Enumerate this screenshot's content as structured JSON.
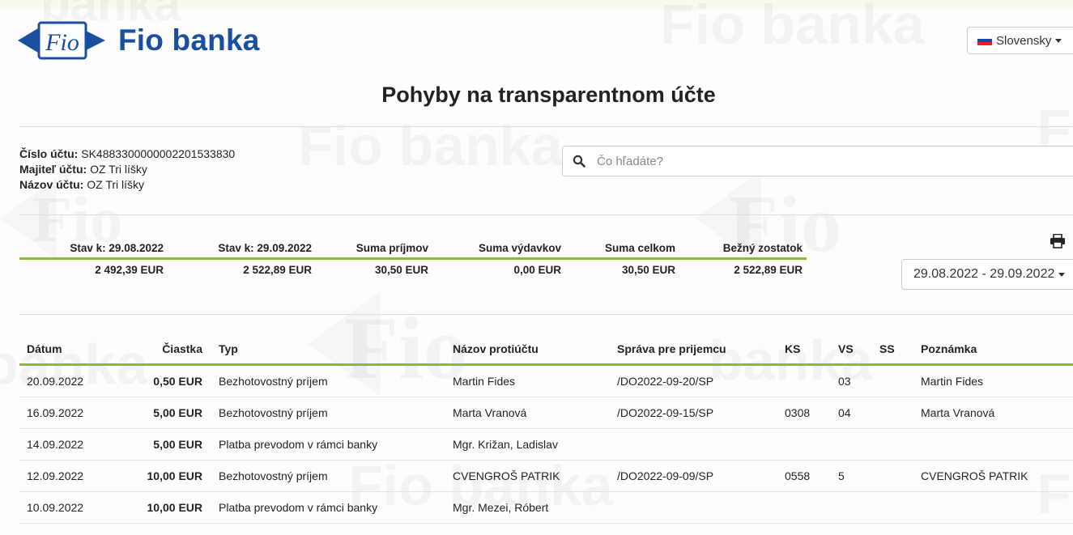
{
  "brand": {
    "name": "Fio banka",
    "logo_mark": "Fio",
    "blue": "#1a4e9f",
    "accent_green": "#8bba3a"
  },
  "language": {
    "selected": "Slovensky",
    "flag_icon": "slovak-flag-icon"
  },
  "page_title": "Pohyby na transparentnom účte",
  "account": {
    "number_label": "Číslo účtu:",
    "number_value": "SK4883300000002201533830",
    "owner_label": "Majiteľ účtu:",
    "owner_value": "OZ Tri líšky",
    "name_label": "Názov účtu:",
    "name_value": "OZ Tri líšky"
  },
  "search": {
    "placeholder": "Čo hľadáte?",
    "value": "",
    "icon": "search-icon"
  },
  "summary": {
    "headers": [
      "Stav k: 29.08.2022",
      "Stav k: 29.09.2022",
      "Suma príjmov",
      "Suma výdavkov",
      "Suma celkom",
      "Bežný zostatok"
    ],
    "values": [
      "2 492,39 EUR",
      "2 522,89 EUR",
      "30,50 EUR",
      "0,00 EUR",
      "30,50 EUR",
      "2 522,89 EUR"
    ]
  },
  "print_icon": "printer-icon",
  "date_range": "29.08.2022 - 29.09.2022",
  "table": {
    "columns": [
      "Dátum",
      "Čiastka",
      "Typ",
      "Názov protiúčtu",
      "Správa pre prijemcu",
      "KS",
      "VS",
      "SS",
      "Poznámka"
    ],
    "rows": [
      [
        "20.09.2022",
        "0,50 EUR",
        "Bezhotovostný príjem",
        "Martin Fides",
        "/DO2022-09-20/SP",
        "",
        "03",
        "",
        "Martin Fides"
      ],
      [
        "16.09.2022",
        "5,00 EUR",
        "Bezhotovostný príjem",
        "Marta Vranová",
        "/DO2022-09-15/SP",
        "0308",
        "04",
        "",
        "Marta Vranová"
      ],
      [
        "14.09.2022",
        "5,00 EUR",
        "Platba prevodom v rámci banky",
        "Mgr. Križan, Ladislav",
        "",
        "",
        "",
        "",
        ""
      ],
      [
        "12.09.2022",
        "10,00 EUR",
        "Bezhotovostný príjem",
        "CVENGROŠ PATRIK",
        "/DO2022-09-09/SP",
        "0558",
        "5",
        "",
        "CVENGROŠ PATRIK"
      ],
      [
        "10.09.2022",
        "10,00 EUR",
        "Platba prevodom v rámci banky",
        "Mgr. Mezei, Róbert",
        "",
        "",
        "",
        "",
        ""
      ]
    ]
  }
}
